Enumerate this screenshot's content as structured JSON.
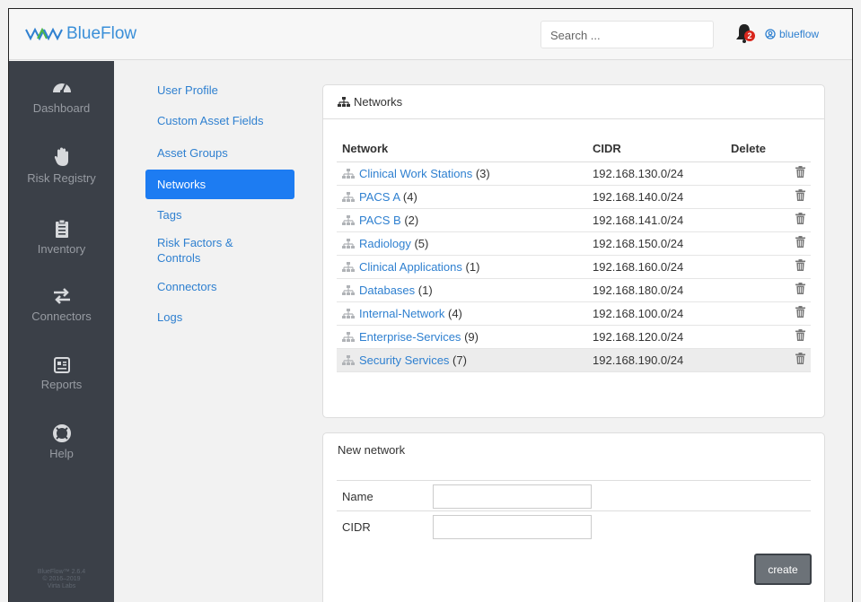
{
  "app": {
    "name": "BlueFlow",
    "version_line1": "BlueFlow™ 2.6.4",
    "version_line2": "© 2016–2019",
    "version_line3": "Virta Labs"
  },
  "header": {
    "search_placeholder": "Search ...",
    "notification_count": "2",
    "username": "blueflow"
  },
  "sidebar": {
    "items": [
      {
        "label": "Dashboard",
        "icon": "dashboard-gauge-icon"
      },
      {
        "label": "Risk Registry",
        "icon": "hand-icon"
      },
      {
        "label": "Inventory",
        "icon": "clipboard-icon"
      },
      {
        "label": "Connectors",
        "icon": "arrows-exchange-icon"
      },
      {
        "label": "Reports",
        "icon": "report-card-icon"
      },
      {
        "label": "Help",
        "icon": "lifebuoy-icon"
      }
    ]
  },
  "settings_menu": {
    "items": [
      {
        "label": "User Profile",
        "active": false
      },
      {
        "label": "Custom Asset Fields",
        "active": false
      },
      {
        "label": "Asset Groups",
        "active": false
      },
      {
        "label": "Networks",
        "active": true
      },
      {
        "label": "Tags",
        "active": false
      },
      {
        "label": "Risk Factors & Controls",
        "active": false
      },
      {
        "label": "Connectors",
        "active": false
      },
      {
        "label": "Logs",
        "active": false
      }
    ]
  },
  "networks_panel": {
    "title": "Networks",
    "columns": [
      "Network",
      "CIDR",
      "Delete"
    ],
    "rows": [
      {
        "name": "Clinical Work Stations",
        "count": "(3)",
        "cidr": "192.168.130.0/24"
      },
      {
        "name": "PACS A",
        "count": "(4)",
        "cidr": "192.168.140.0/24"
      },
      {
        "name": "PACS B",
        "count": "(2)",
        "cidr": "192.168.141.0/24"
      },
      {
        "name": "Radiology",
        "count": "(5)",
        "cidr": "192.168.150.0/24"
      },
      {
        "name": "Clinical Applications",
        "count": "(1)",
        "cidr": "192.168.160.0/24"
      },
      {
        "name": "Databases",
        "count": "(1)",
        "cidr": "192.168.180.0/24"
      },
      {
        "name": "Internal-Network",
        "count": "(4)",
        "cidr": "192.168.100.0/24"
      },
      {
        "name": "Enterprise-Services",
        "count": "(9)",
        "cidr": "192.168.120.0/24"
      },
      {
        "name": "Security Services",
        "count": "(7)",
        "cidr": "192.168.190.0/24"
      }
    ],
    "highlighted_row": "Security Services"
  },
  "new_network_panel": {
    "title": "New network",
    "name_label": "Name",
    "name_value": "",
    "cidr_label": "CIDR",
    "cidr_value": "",
    "create_label": "create"
  },
  "colors": {
    "accent": "#1d7cf2",
    "link": "#2f80d0",
    "sidebar_bg": "#3b4048",
    "badge": "#d9261c"
  }
}
